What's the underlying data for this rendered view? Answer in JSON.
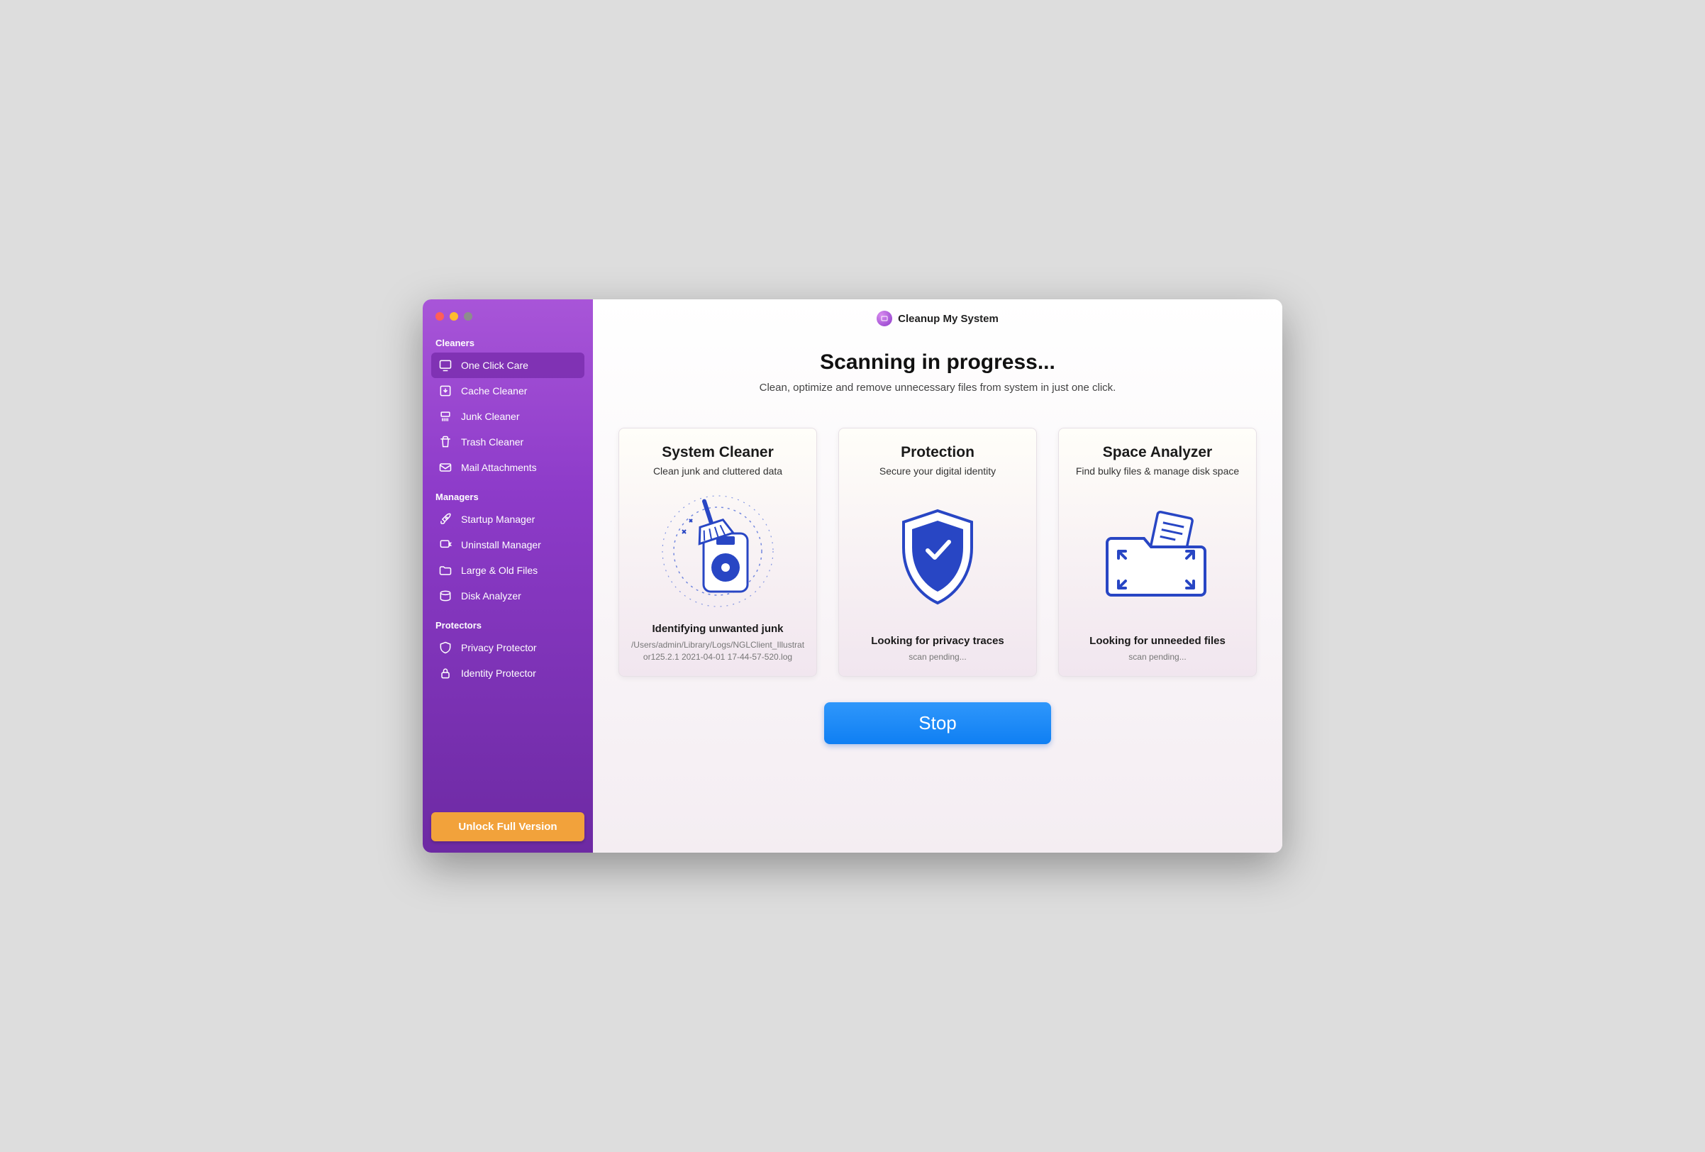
{
  "titlebar": {
    "app_name": "Cleanup My System"
  },
  "sidebar": {
    "sections": {
      "cleaners": {
        "title": "Cleaners",
        "items": [
          {
            "label": "One Click Care"
          },
          {
            "label": "Cache Cleaner"
          },
          {
            "label": "Junk Cleaner"
          },
          {
            "label": "Trash Cleaner"
          },
          {
            "label": "Mail Attachments"
          }
        ]
      },
      "managers": {
        "title": "Managers",
        "items": [
          {
            "label": "Startup Manager"
          },
          {
            "label": "Uninstall Manager"
          },
          {
            "label": "Large & Old Files"
          },
          {
            "label": "Disk Analyzer"
          }
        ]
      },
      "protectors": {
        "title": "Protectors",
        "items": [
          {
            "label": "Privacy Protector"
          },
          {
            "label": "Identity Protector"
          }
        ]
      }
    },
    "unlock_label": "Unlock Full Version"
  },
  "hero": {
    "title": "Scanning in progress...",
    "subtitle": "Clean, optimize and remove unnecessary files from system in just one click."
  },
  "cards": {
    "system_cleaner": {
      "title": "System Cleaner",
      "subtitle": "Clean junk and cluttered data",
      "status": "Identifying unwanted junk",
      "detail": "/Users/admin/Library/Logs/NGLClient_Illustrator125.2.1 2021-04-01 17-44-57-520.log"
    },
    "protection": {
      "title": "Protection",
      "subtitle": "Secure your digital identity",
      "status": "Looking for privacy traces",
      "detail": "scan pending..."
    },
    "space_analyzer": {
      "title": "Space Analyzer",
      "subtitle": "Find bulky files & manage disk space",
      "status": "Looking for unneeded files",
      "detail": "scan pending..."
    }
  },
  "actions": {
    "stop_label": "Stop"
  }
}
